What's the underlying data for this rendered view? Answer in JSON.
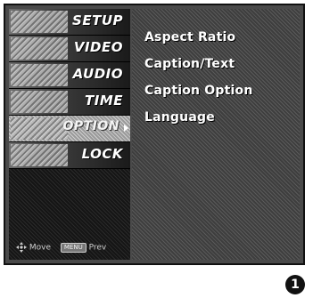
{
  "menu": {
    "items": [
      {
        "label": "SETUP",
        "active": false
      },
      {
        "label": "VIDEO",
        "active": false
      },
      {
        "label": "AUDIO",
        "active": false
      },
      {
        "label": "TIME",
        "active": false
      },
      {
        "label": "OPTION",
        "active": true
      },
      {
        "label": "LOCK",
        "active": false
      }
    ]
  },
  "submenu": {
    "items": [
      "Aspect Ratio",
      "Caption/Text",
      "Caption Option",
      "Language"
    ]
  },
  "hints": {
    "move_label": "Move",
    "prev_key": "MENU",
    "prev_label": "Prev"
  },
  "footnote_marker": "1"
}
